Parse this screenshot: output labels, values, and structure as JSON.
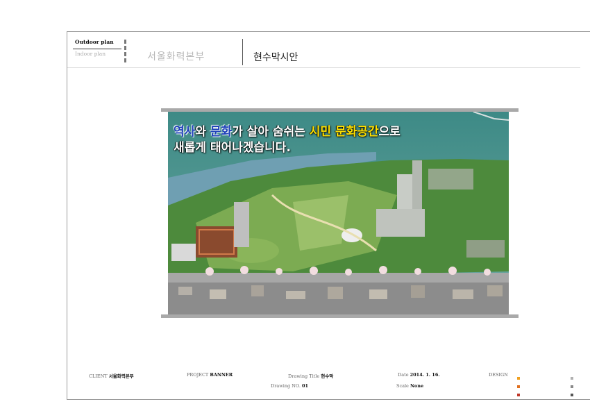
{
  "header": {
    "tab_outdoor": "Outdoor plan",
    "tab_indoor": "Indoor plan",
    "organization": "서울화력본부",
    "project_title": "현수막시안"
  },
  "banner": {
    "headline_1_a": "역사",
    "headline_1_b": "와 ",
    "headline_1_c": "문화",
    "headline_1_d": "가 살아 숨쉬는 ",
    "headline_1_e": "시민 문화공간",
    "headline_1_f": "으로",
    "headline_2": "새롭게 태어나겠습니다."
  },
  "footer": {
    "client_label": "CLIENT",
    "client_value": "서울화력본부",
    "project_label": "PROJECT",
    "project_value": "BANNER",
    "drawing_title_label": "Drawing Title",
    "drawing_title_value": "현수막",
    "drawing_no_label": "Drawing NO.",
    "drawing_no_value": "01",
    "date_label": "Date",
    "date_value": "2014. 1. 16.",
    "scale_label": "Scale",
    "scale_value": "None",
    "design_label": "DESIGN"
  },
  "colors": {
    "accent_orange": "#f0a020",
    "accent_red": "#c0392b",
    "accent_gray": "#8a8a8a"
  }
}
